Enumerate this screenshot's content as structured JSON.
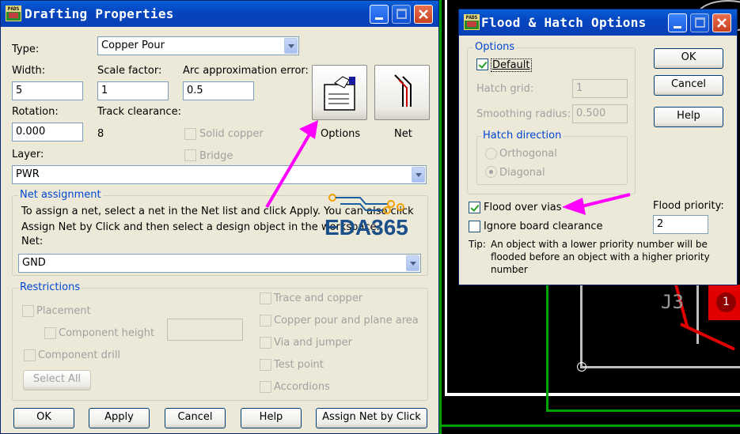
{
  "drafting": {
    "title": "Drafting Properties",
    "type_label": "Type:",
    "type_value": "Copper Pour",
    "width_label": "Width:",
    "width_value": "5",
    "scale_label": "Scale factor:",
    "scale_value": "1",
    "arc_label": "Arc approximation error:",
    "arc_value": "0.5",
    "rotation_label": "Rotation:",
    "rotation_value": "0.000",
    "track_label": "Track clearance:",
    "track_value": "8",
    "solid_copper": "Solid copper",
    "bridge": "Bridge",
    "options_label": "Options",
    "net_label": "Net",
    "layer_label": "Layer:",
    "layer_value": "PWR",
    "net_assign_title": "Net assignment",
    "net_assign_text1": "To assign a net, select a net in the Net list and click Apply. You can also click",
    "net_assign_text2": "Assign Net by Click and then select a design object in the workspace.",
    "net_field_label": "Net:",
    "net_value": "GND",
    "restrictions_title": "Restrictions",
    "placement": "Placement",
    "component_height": "Component height",
    "component_drill": "Component drill",
    "select_all": "Select All",
    "trace_copper": "Trace and copper",
    "copper_pour_plane": "Copper pour and plane area",
    "via_jumper": "Via and jumper",
    "test_point": "Test point",
    "accordions": "Accordions",
    "ok": "OK",
    "apply": "Apply",
    "cancel": "Cancel",
    "help": "Help",
    "assign_by_click": "Assign Net by Click"
  },
  "watermark": {
    "text": "EDA365"
  },
  "flood": {
    "title": "Flood & Hatch Options",
    "options_title": "Options",
    "default": "Default",
    "hatch_grid_label": "Hatch grid:",
    "hatch_grid_value": "1",
    "smoothing_label": "Smoothing radius:",
    "smoothing_value": "0.500",
    "hatch_dir_title": "Hatch direction",
    "orthogonal": "Orthogonal",
    "diagonal": "Diagonal",
    "flood_over_vias": "Flood over vias",
    "ignore_board": "Ignore board clearance",
    "flood_priority_label": "Flood priority:",
    "flood_priority_value": "2",
    "tip_label": "Tip:",
    "tip_text1": "An object with a lower priority number will be",
    "tip_text2": "flooded before an object with a higher priority",
    "tip_text3": "number",
    "ok": "OK",
    "cancel": "Cancel",
    "help": "Help"
  },
  "pcb": {
    "ref": "J3",
    "pad": "1"
  },
  "colors": {
    "arrow": "#ff00ff",
    "title_blue": "#0a5fd8",
    "group_title": "#0046d5"
  }
}
